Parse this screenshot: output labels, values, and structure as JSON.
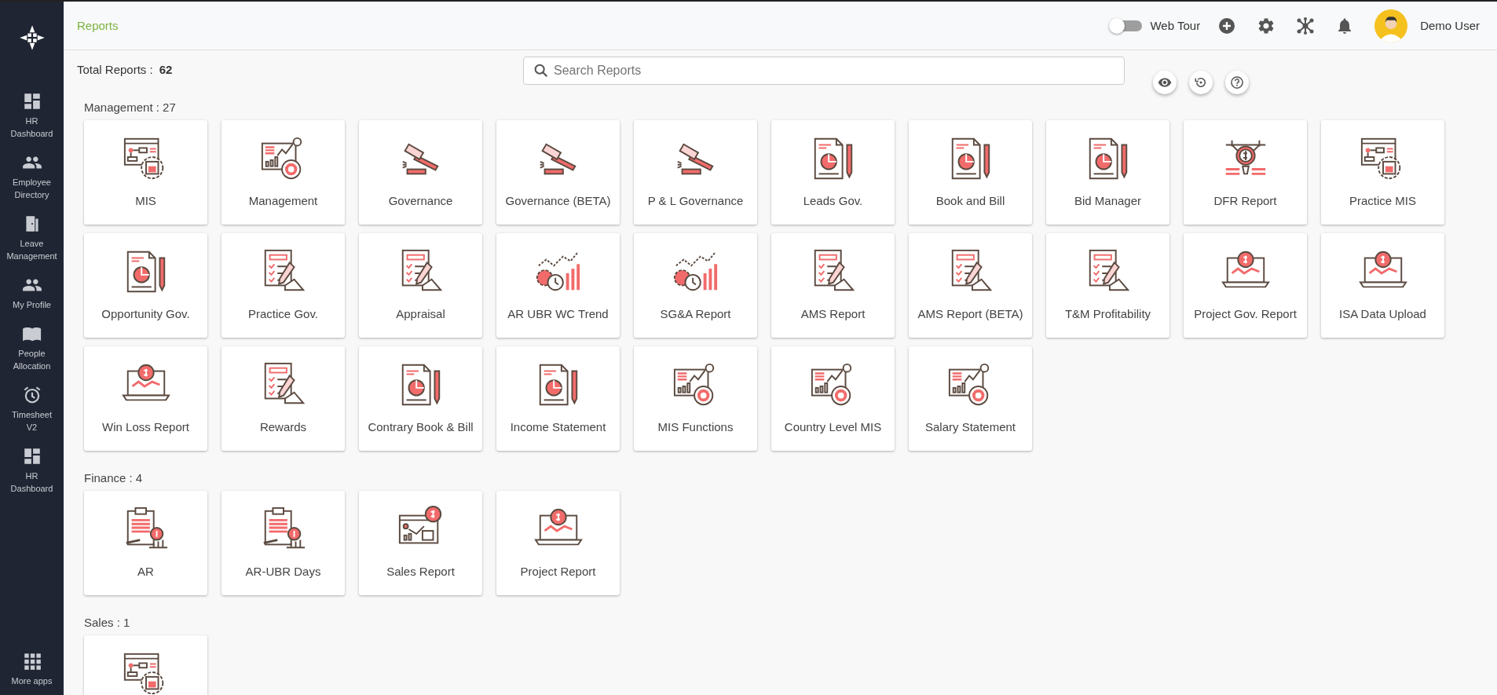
{
  "sidebar": {
    "items": [
      {
        "label": "HR Dashboard",
        "kind": "dashboard"
      },
      {
        "label": "Employee Directory",
        "kind": "people"
      },
      {
        "label": "Leave Management",
        "kind": "door"
      },
      {
        "label": "My Profile",
        "kind": "people"
      },
      {
        "label": "People Allocation",
        "kind": "book"
      },
      {
        "label": "Timesheet V2",
        "kind": "alarm"
      },
      {
        "label": "HR Dashboard",
        "kind": "dashboard"
      }
    ],
    "more": {
      "label": "More apps"
    }
  },
  "header": {
    "breadcrumb": "Reports",
    "web_tour": {
      "label": "Web Tour",
      "on": false
    },
    "user": "Demo User"
  },
  "toolbar": {
    "total_label": "Total Reports :",
    "total": "62",
    "search": {
      "placeholder": "Search Reports"
    }
  },
  "sections": [
    {
      "title": "Management : 27",
      "reports": [
        {
          "label": "MIS",
          "kind": "window"
        },
        {
          "label": "Management",
          "kind": "chart"
        },
        {
          "label": "Governance",
          "kind": "gavel"
        },
        {
          "label": "Governance (BETA)",
          "kind": "gavel"
        },
        {
          "label": "P & L Governance",
          "kind": "gavel"
        },
        {
          "label": "Leads Gov.",
          "kind": "document"
        },
        {
          "label": "Book and Bill",
          "kind": "document"
        },
        {
          "label": "Bid Manager",
          "kind": "document"
        },
        {
          "label": "DFR Report",
          "kind": "coin"
        },
        {
          "label": "Practice MIS",
          "kind": "window"
        },
        {
          "label": "Opportunity Gov.",
          "kind": "document"
        },
        {
          "label": "Practice Gov.",
          "kind": "checklist"
        },
        {
          "label": "Appraisal",
          "kind": "checklist"
        },
        {
          "label": "AR UBR WC Trend",
          "kind": "trend"
        },
        {
          "label": "SG&A Report",
          "kind": "trend"
        },
        {
          "label": "AMS Report",
          "kind": "checklist"
        },
        {
          "label": "AMS Report (BETA)",
          "kind": "checklist"
        },
        {
          "label": "T&M Profitability",
          "kind": "checklist"
        },
        {
          "label": "Project Gov. Report",
          "kind": "laptop"
        },
        {
          "label": "ISA Data Upload",
          "kind": "laptop"
        },
        {
          "label": "Win Loss Report",
          "kind": "laptop"
        },
        {
          "label": "Rewards",
          "kind": "checklist"
        },
        {
          "label": "Contrary Book & Bill",
          "kind": "document"
        },
        {
          "label": "Income Statement",
          "kind": "document"
        },
        {
          "label": "MIS Functions",
          "kind": "chart"
        },
        {
          "label": "Country Level MIS",
          "kind": "chart"
        },
        {
          "label": "Salary Statement",
          "kind": "chart"
        }
      ]
    },
    {
      "title": "Finance : 4",
      "reports": [
        {
          "label": "AR",
          "kind": "clipboard"
        },
        {
          "label": "AR-UBR Days",
          "kind": "clipboard"
        },
        {
          "label": "Sales Report",
          "kind": "board"
        },
        {
          "label": "Project Report",
          "kind": "laptop"
        }
      ]
    },
    {
      "title": "Sales : 1",
      "reports": [
        {
          "kind": "window"
        }
      ]
    }
  ]
}
